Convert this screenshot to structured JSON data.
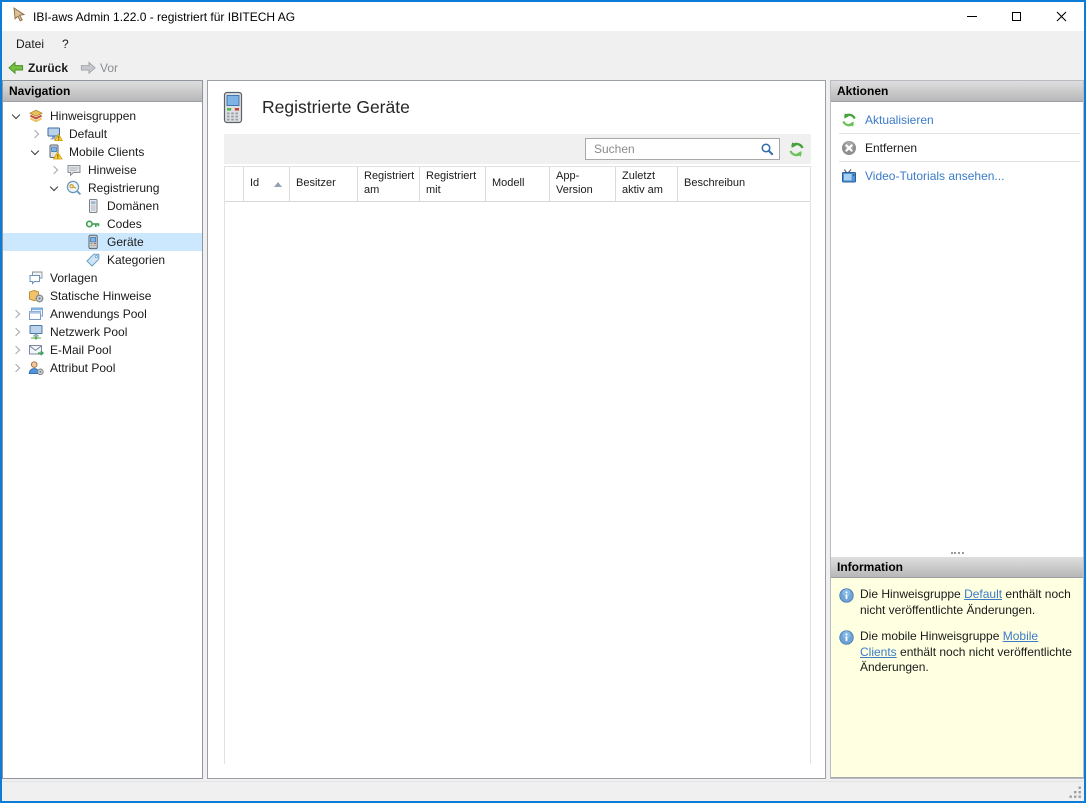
{
  "window": {
    "title": "IBI-aws Admin 1.22.0 - registriert für IBITECH AG"
  },
  "menu": {
    "items": [
      {
        "label": "Datei"
      },
      {
        "label": "?"
      }
    ]
  },
  "toolbar": {
    "back_label": "Zurück",
    "forward_label": "Vor"
  },
  "sidebar": {
    "header": "Navigation",
    "tree": [
      {
        "label": "Hinweisgruppen",
        "level": 0,
        "chevron": "expanded",
        "icon": "notice-groups-icon",
        "selected": false
      },
      {
        "label": "Default",
        "level": 1,
        "chevron": "collapsed",
        "icon": "monitor-warning-icon",
        "selected": false
      },
      {
        "label": "Mobile Clients",
        "level": 1,
        "chevron": "expanded",
        "icon": "mobile-warning-icon",
        "selected": false
      },
      {
        "label": "Hinweise",
        "level": 2,
        "chevron": "collapsed",
        "icon": "speech-bubble-icon",
        "selected": false
      },
      {
        "label": "Registrierung",
        "level": 2,
        "chevron": "expanded",
        "icon": "registration-icon",
        "selected": false
      },
      {
        "label": "Domänen",
        "level": 3,
        "chevron": "none",
        "icon": "domain-icon",
        "selected": false
      },
      {
        "label": "Codes",
        "level": 3,
        "chevron": "none",
        "icon": "key-icon",
        "selected": false
      },
      {
        "label": "Geräte",
        "level": 3,
        "chevron": "none",
        "icon": "device-icon",
        "selected": true
      },
      {
        "label": "Kategorien",
        "level": 3,
        "chevron": "none",
        "icon": "tag-icon",
        "selected": false
      },
      {
        "label": "Vorlagen",
        "level": 0,
        "chevron": "none",
        "icon": "templates-icon",
        "selected": false
      },
      {
        "label": "Statische Hinweise",
        "level": 0,
        "chevron": "none",
        "icon": "static-notices-icon",
        "selected": false
      },
      {
        "label": "Anwendungs Pool",
        "level": 0,
        "chevron": "collapsed",
        "icon": "application-pool-icon",
        "selected": false
      },
      {
        "label": "Netzwerk Pool",
        "level": 0,
        "chevron": "collapsed",
        "icon": "network-pool-icon",
        "selected": false
      },
      {
        "label": "E-Mail Pool",
        "level": 0,
        "chevron": "collapsed",
        "icon": "email-pool-icon",
        "selected": false
      },
      {
        "label": "Attribut Pool",
        "level": 0,
        "chevron": "collapsed",
        "icon": "attribute-pool-icon",
        "selected": false
      }
    ]
  },
  "main": {
    "title": "Registrierte Geräte",
    "search": {
      "placeholder": "Suchen"
    },
    "table": {
      "columns": [
        {
          "label": ""
        },
        {
          "label": "Id",
          "sorted": "asc"
        },
        {
          "label": "Besitzer"
        },
        {
          "label": "Registriert am"
        },
        {
          "label": "Registriert mit"
        },
        {
          "label": "Modell"
        },
        {
          "label": "App-Version"
        },
        {
          "label": "Zuletzt aktiv am"
        },
        {
          "label": "Beschreibun"
        }
      ],
      "rows": []
    }
  },
  "actions": {
    "header": "Aktionen",
    "items": [
      {
        "label": "Aktualisieren",
        "icon": "refresh-icon"
      },
      {
        "label": "Entfernen",
        "icon": "remove-icon"
      },
      {
        "label": "Video-Tutorials ansehen...",
        "icon": "video-icon"
      }
    ]
  },
  "information": {
    "header": "Information",
    "items": [
      {
        "before": "Die Hinweisgruppe ",
        "link": "Default",
        "after": " enthält noch nicht veröffentlichte Änderungen."
      },
      {
        "before": "Die mobile Hinweisgruppe ",
        "link": "Mobile Clients",
        "after": " enthält noch nicht veröffentlichte Änderungen."
      }
    ]
  },
  "icons": {
    "app": "hand-pointer-icon",
    "search": "magnifier-icon",
    "refresh": "refresh-arrows-icon",
    "info": "info-circle-icon",
    "sort": "sort-ascending-arrow"
  },
  "colors": {
    "window_border": "#0d7cd6",
    "selection": "#cce8ff",
    "link": "#3b7bc8",
    "info_background": "#ffffe1"
  }
}
